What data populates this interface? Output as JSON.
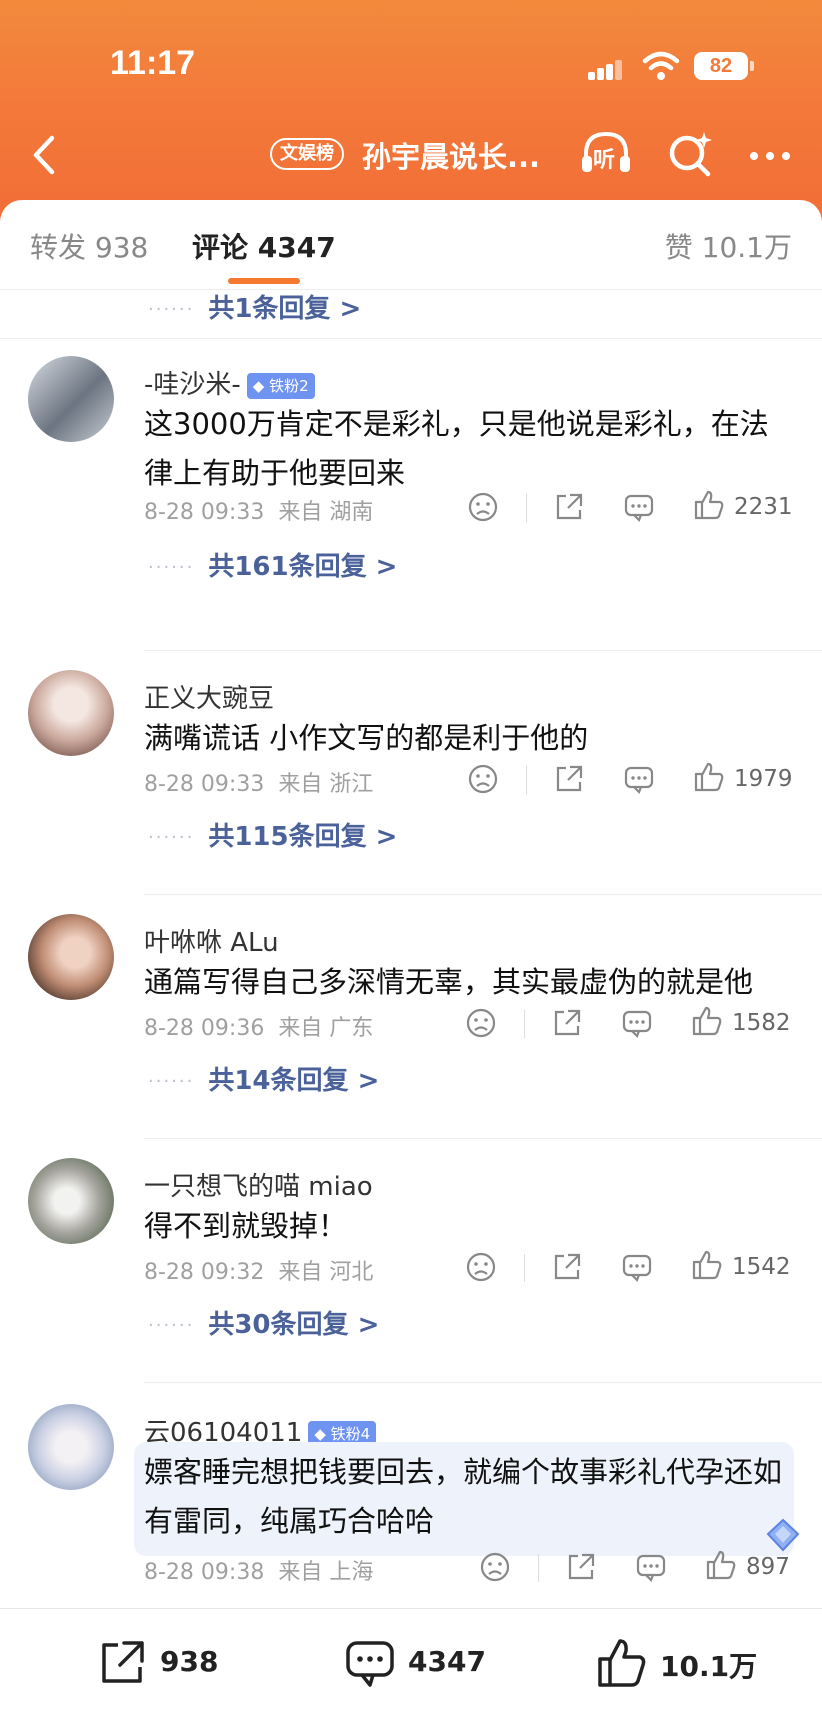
{
  "status_bar": {
    "time": "11:17",
    "battery": "82"
  },
  "nav": {
    "hot_badge": "文娱榜",
    "title": "孙宇晨说长...",
    "listen_label": "听"
  },
  "tabs": {
    "repost": "转发 938",
    "comment": "评论 4347",
    "like": "赞 10.1万"
  },
  "top_reply_link": "共1条回复 >",
  "comments": [
    {
      "username": "-哇沙米-",
      "badge": "铁粉2",
      "text": "这3000万肯定不是彩礼，只是他说是彩礼，在法律上有助于他要回来",
      "time": "8-28 09:33",
      "location": "来自 湖南",
      "likes": "2231",
      "replies": "共161条回复 >"
    },
    {
      "username": "正义大豌豆",
      "badge": "",
      "text": "满嘴谎话 小作文写的都是利于他的",
      "time": "8-28 09:33",
      "location": "来自 浙江",
      "likes": "1979",
      "replies": "共115条回复 >"
    },
    {
      "username": "叶咻咻 ALu",
      "badge": "",
      "text": "通篇写得自己多深情无辜，其实最虚伪的就是他",
      "time": "8-28 09:36",
      "location": "来自 广东",
      "likes": "1582",
      "replies": "共14条回复 >"
    },
    {
      "username": "一只想飞的喵 miao",
      "badge": "",
      "text": "得不到就毁掉！",
      "time": "8-28 09:32",
      "location": "来自 河北",
      "likes": "1542",
      "replies": "共30条回复 >"
    },
    {
      "username": "云06104011",
      "badge": "铁粉4",
      "text": "嫖客睡完想把钱要回去，就编个故事彩礼代孕还如有雷同，纯属巧合哈哈",
      "time": "8-28 09:38",
      "location": "来自 上海",
      "likes": "897",
      "replies": ""
    }
  ],
  "bottom_bar": {
    "repost_count": "938",
    "comment_count": "4347",
    "like_count": "10.1万"
  },
  "colors": {
    "header_orange": "#f27a3a",
    "link_blue": "#4a6199",
    "badge_blue": "#6f93f0",
    "tab_underline": "#f57a2f"
  }
}
